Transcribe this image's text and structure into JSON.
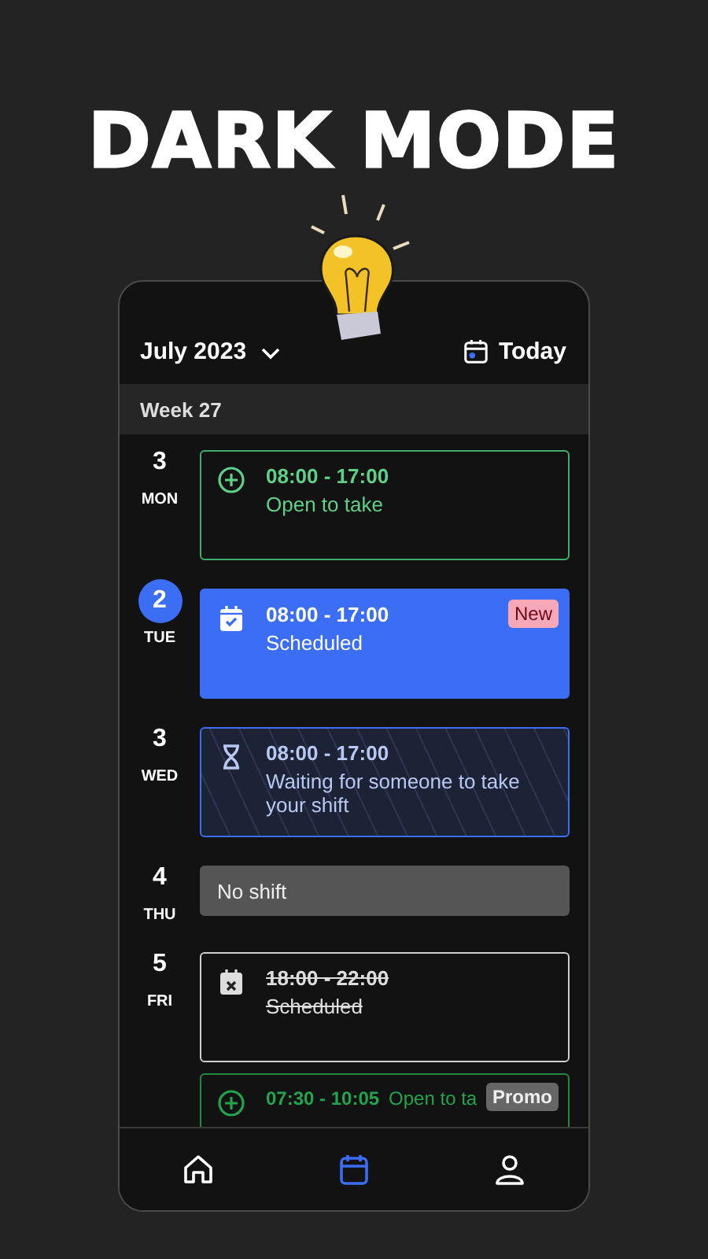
{
  "headline": "DARK MODE",
  "header": {
    "month": "July 2023",
    "today_button": "Today"
  },
  "week": "Week 27",
  "days": [
    {
      "number": "3",
      "weekday": "MON",
      "today": false,
      "shifts": [
        {
          "kind": "open",
          "time": "08:00 - 17:00",
          "status": "Open to take",
          "inline": false
        }
      ]
    },
    {
      "number": "2",
      "weekday": "TUE",
      "today": true,
      "shifts": [
        {
          "kind": "scheduled",
          "time": "08:00 - 17:00",
          "status": "Scheduled",
          "badge": "New",
          "inline": false
        }
      ]
    },
    {
      "number": "3",
      "weekday": "WED",
      "today": false,
      "shifts": [
        {
          "kind": "pending",
          "time": "08:00 - 17:00",
          "status": "Waiting for someone to take your shift",
          "inline": false
        }
      ]
    },
    {
      "number": "4",
      "weekday": "THU",
      "today": false,
      "shifts": [
        {
          "kind": "none",
          "status": "No shift",
          "inline": false
        }
      ]
    },
    {
      "number": "5",
      "weekday": "FRI",
      "today": false,
      "shifts": [
        {
          "kind": "cancelled",
          "time": "18:00 - 22:00",
          "status": "Scheduled",
          "inline": false
        },
        {
          "kind": "open",
          "time": "07:30 - 10:05",
          "status": "Open to ta",
          "badge": "Promo",
          "inline": true
        }
      ]
    }
  ],
  "nav": [
    {
      "kind": "home",
      "selected": false
    },
    {
      "kind": "calendar",
      "selected": true
    },
    {
      "kind": "profile",
      "selected": false
    }
  ]
}
